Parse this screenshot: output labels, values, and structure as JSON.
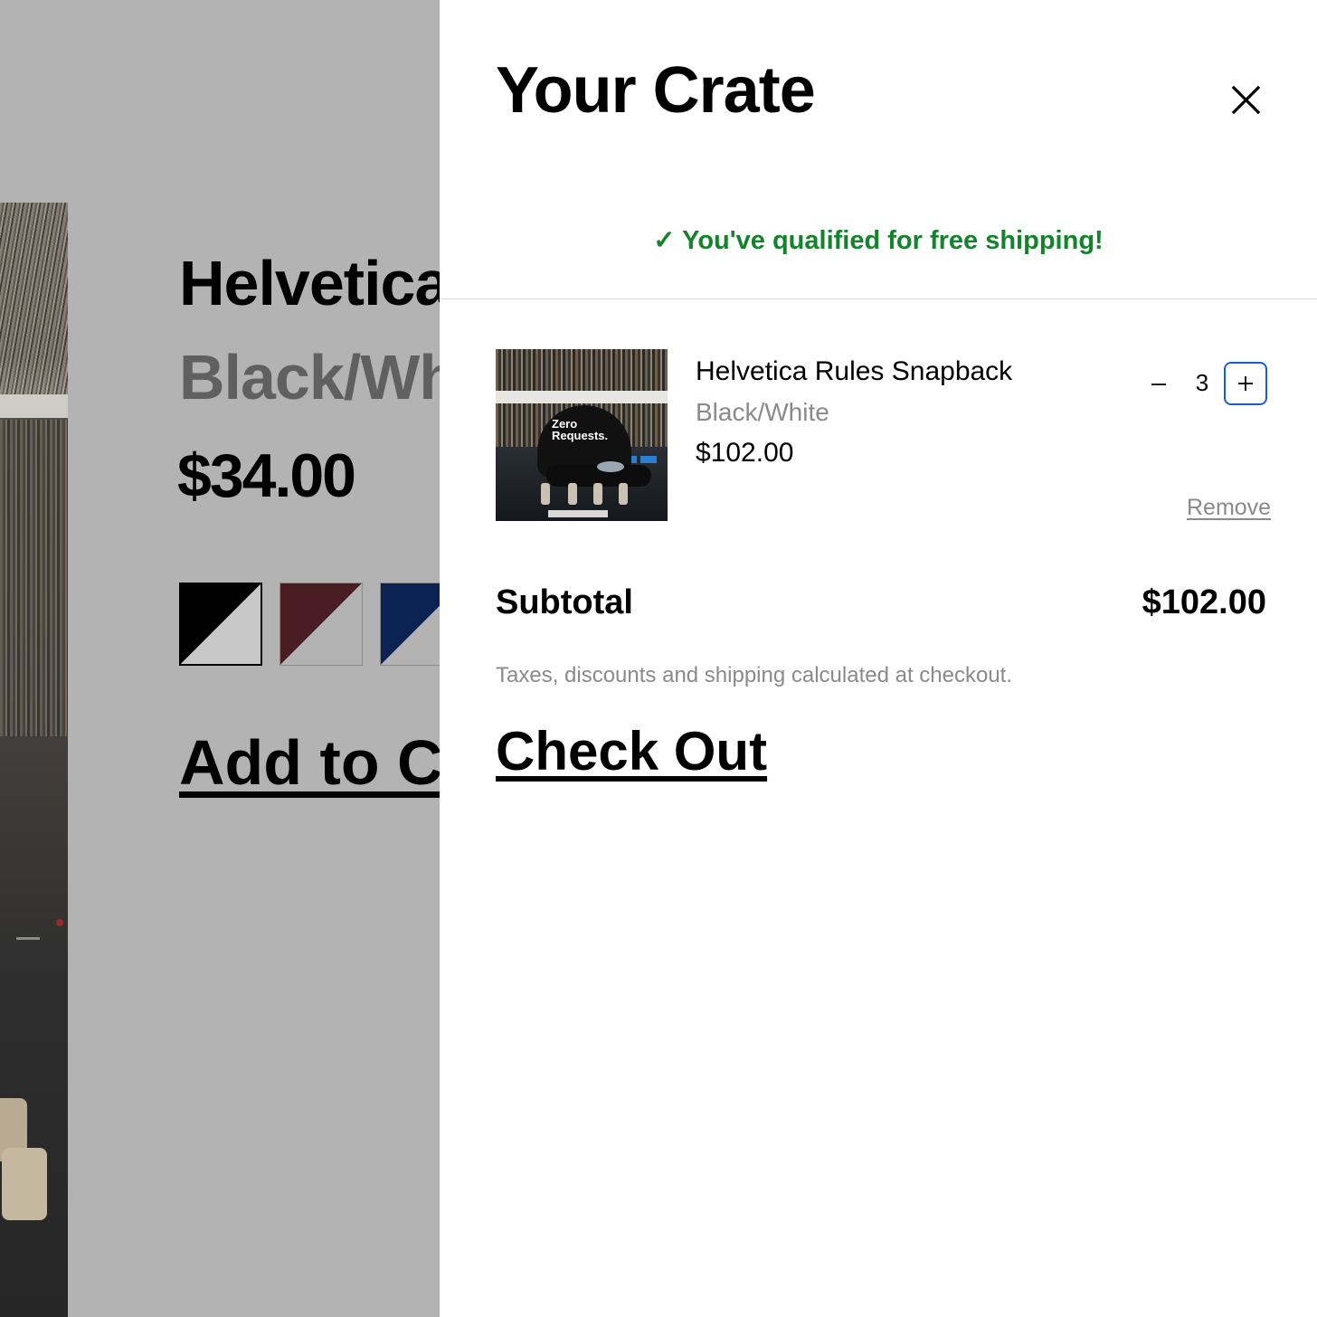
{
  "background_page": {
    "product_title": "Helvetica Rules Snapback",
    "variant": "Black/White",
    "price": "$34.00",
    "swatches": [
      {
        "name": "black-white",
        "color": "#000000"
      },
      {
        "name": "burgundy-white",
        "color": "#4a1c24"
      },
      {
        "name": "navy-white",
        "color": "#0a2352"
      }
    ],
    "add_button_label": "Add to Crate"
  },
  "cart": {
    "title": "Your Crate",
    "close_icon": "close-icon",
    "shipping_message": "✓ You've qualified for free shipping!",
    "shipping_color": "#13832c",
    "items": [
      {
        "name": "Helvetica Rules Snapback",
        "variant": "Black/White",
        "price": "$102.00",
        "quantity": "3",
        "thumb_text": "Zero Requests.",
        "remove_label": "Remove"
      }
    ],
    "subtotal_label": "Subtotal",
    "subtotal_value": "$102.00",
    "tax_note": "Taxes, discounts and shipping calculated at checkout.",
    "checkout_label": "Check Out",
    "focus_color": "#1a5fd0"
  }
}
